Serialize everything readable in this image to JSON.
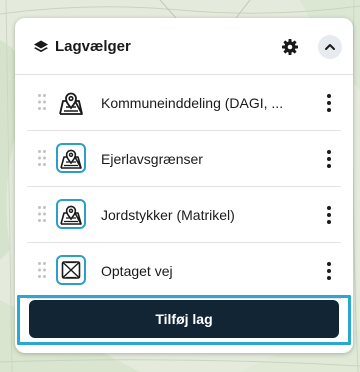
{
  "panel": {
    "title": "Lagvælger",
    "header_icon": "layers-icon",
    "settings_icon": "gear-icon",
    "collapse_icon": "chevron-up-icon"
  },
  "layers": [
    {
      "label": "Kommuneinddeling (DAGI, ...",
      "icon": "map-pin-icon"
    },
    {
      "label": "Ejerlavsgrænser",
      "icon": "map-pin-icon"
    },
    {
      "label": "Jordstykker (Matrikel)",
      "icon": "map-pin-icon"
    },
    {
      "label": "Optaget vej",
      "icon": "crossed-map-icon"
    }
  ],
  "actions": {
    "add_layer_label": "Tilføj lag"
  },
  "colors": {
    "accent": "#2e9fc4",
    "button_bg": "#112535",
    "highlight_border": "#29a8d3"
  }
}
